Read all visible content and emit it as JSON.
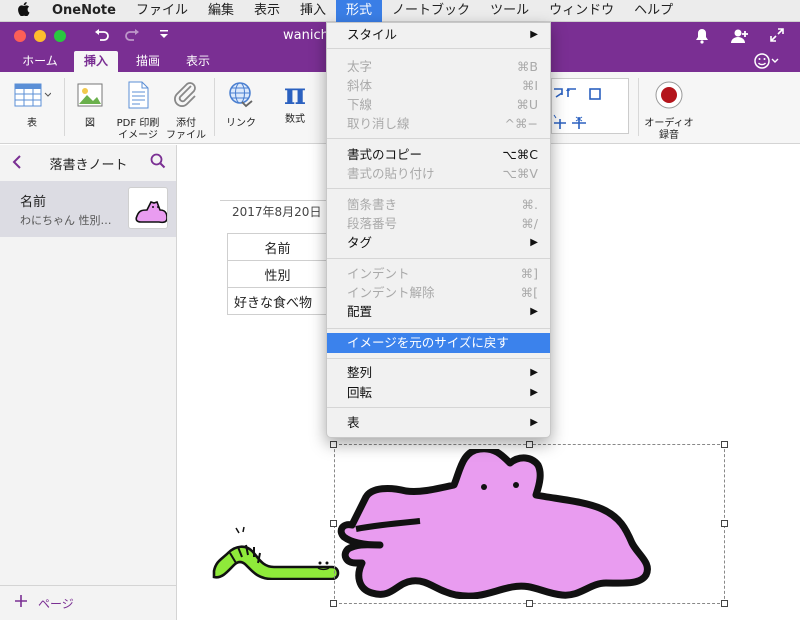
{
  "menubar": {
    "apple": "",
    "items": [
      "OneNote",
      "ファイル",
      "編集",
      "表示",
      "挿入",
      "形式",
      "ノートブック",
      "ツール",
      "ウィンドウ",
      "ヘルプ"
    ],
    "active_index": 5
  },
  "window": {
    "title": "wanicha"
  },
  "ribbon_tabs": [
    "ホーム",
    "挿入",
    "描画",
    "表示"
  ],
  "ribbon_selected": 1,
  "ribbon": {
    "table_label": "表",
    "picture_label": "図",
    "pdf_label_1": "PDF 印刷",
    "pdf_label_2": "イメージ",
    "attach_label_1": "添付",
    "attach_label_2": "ファイル",
    "link_label": "リンク",
    "equation_label": "数式",
    "equation_glyph": "π",
    "audio_label_1": "オーディオ",
    "audio_label_2": "録音"
  },
  "sidebar": {
    "notebook_title": "落書きノート",
    "page_title": "名前",
    "page_preview": "わにちゃん  性別…",
    "add_page_label": "ページ"
  },
  "note": {
    "date": "2017年8月20日",
    "rows": [
      "名前",
      "性別",
      "好きな食べ物"
    ]
  },
  "format_menu": {
    "items": [
      {
        "label": "スタイル",
        "shortcut": "",
        "submenu": true,
        "disabled": false
      },
      {
        "label": "太字",
        "shortcut": "⌘B",
        "submenu": false,
        "disabled": true
      },
      {
        "label": "斜体",
        "shortcut": "⌘I",
        "submenu": false,
        "disabled": true
      },
      {
        "label": "下線",
        "shortcut": "⌘U",
        "submenu": false,
        "disabled": true
      },
      {
        "label": "取り消し線",
        "shortcut": "^⌘−",
        "submenu": false,
        "disabled": true
      },
      {
        "label": "書式のコピー",
        "shortcut": "⌥⌘C",
        "submenu": false,
        "disabled": false
      },
      {
        "label": "書式の貼り付け",
        "shortcut": "⌥⌘V",
        "submenu": false,
        "disabled": true
      },
      {
        "label": "箇条書き",
        "shortcut": "⌘.",
        "submenu": false,
        "disabled": true
      },
      {
        "label": "段落番号",
        "shortcut": "⌘/",
        "submenu": false,
        "disabled": true
      },
      {
        "label": "タグ",
        "shortcut": "",
        "submenu": true,
        "disabled": false
      },
      {
        "label": "インデント",
        "shortcut": "⌘]",
        "submenu": false,
        "disabled": true
      },
      {
        "label": "インデント解除",
        "shortcut": "⌘[",
        "submenu": false,
        "disabled": true
      },
      {
        "label": "配置",
        "shortcut": "",
        "submenu": true,
        "disabled": false
      },
      {
        "label": "イメージを元のサイズに戻す",
        "shortcut": "",
        "submenu": false,
        "disabled": false,
        "highlighted": true
      },
      {
        "label": "整列",
        "shortcut": "",
        "submenu": true,
        "disabled": false
      },
      {
        "label": "回転",
        "shortcut": "",
        "submenu": true,
        "disabled": false
      },
      {
        "label": "表",
        "shortcut": "",
        "submenu": true,
        "disabled": false
      }
    ],
    "arrow": "▶"
  },
  "colors": {
    "accent": "#7a2f93",
    "highlight": "#3b82ec",
    "croc_fill": "#e99cf0",
    "worm_fill": "#8fea3a"
  }
}
